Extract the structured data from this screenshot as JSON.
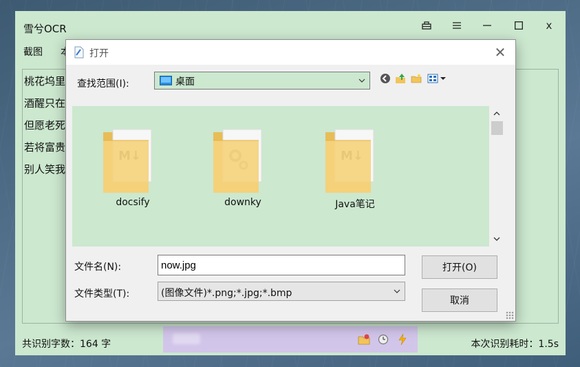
{
  "app": {
    "title": "雪兮OCR",
    "controls": {
      "pin": "⊟",
      "menu": "≡",
      "minimize": "—",
      "maximize": "☐",
      "close": "x"
    },
    "menu": [
      "截图",
      "本"
    ],
    "ocr_lines": [
      "桃花坞里",
      "酒醒只在",
      "但愿老死",
      "若将富贵",
      "别人笑我"
    ],
    "status_left": "共识别字数：164 字",
    "status_right": "本次识别耗时：1.5s"
  },
  "float_toolbar": {
    "icons": [
      "folder-star-icon",
      "clock-icon",
      "lightning-icon"
    ]
  },
  "dialog": {
    "title": "打开",
    "lookin_label": "查找范围(I):",
    "lookin_value": "桌面",
    "files": [
      {
        "name": "docsify",
        "icon": "markdown-folder-icon"
      },
      {
        "name": "downky",
        "icon": "settings-folder-icon"
      },
      {
        "name": "Java笔记",
        "icon": "markdown-folder-icon"
      }
    ],
    "filename_label": "文件名(N):",
    "filename_value": "now.jpg",
    "filetype_label": "文件类型(T):",
    "filetype_value": "(图像文件)*.png;*.jpg;*.bmp",
    "open_button": "打开(O)",
    "cancel_button": "取消"
  },
  "colors": {
    "eye_green": "#cce8cf",
    "toolbar_purple": "#d2c5ea",
    "folder_yellow": "#f3d37a"
  }
}
